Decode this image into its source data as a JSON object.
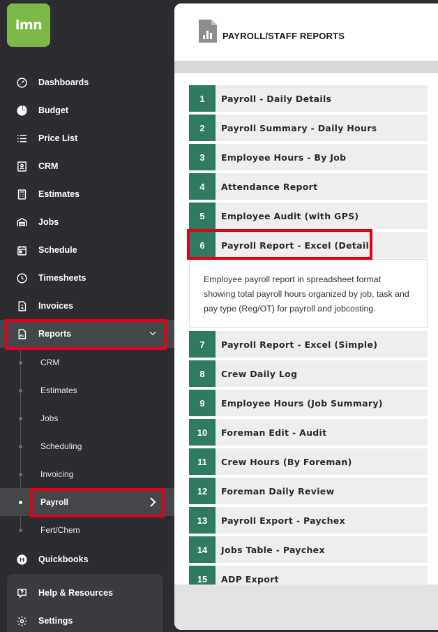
{
  "app": {
    "logo_text": "lmn",
    "brand_color": "#7cb848",
    "accent_color": "#2e7b5f"
  },
  "sidebar": {
    "items": [
      {
        "label": "Dashboards",
        "icon": "gauge-icon"
      },
      {
        "label": "Budget",
        "icon": "pie-chart-icon"
      },
      {
        "label": "Price List",
        "icon": "list-icon"
      },
      {
        "label": "CRM",
        "icon": "contact-card-icon"
      },
      {
        "label": "Estimates",
        "icon": "calculator-icon"
      },
      {
        "label": "Jobs",
        "icon": "garage-icon"
      },
      {
        "label": "Schedule",
        "icon": "calendar-icon"
      },
      {
        "label": "Timesheets",
        "icon": "clock-icon"
      },
      {
        "label": "Invoices",
        "icon": "invoice-icon"
      },
      {
        "label": "Reports",
        "icon": "report-icon"
      }
    ],
    "reports_submenu": [
      "CRM",
      "Estimates",
      "Jobs",
      "Scheduling",
      "Invoicing",
      "Payroll",
      "Fert/Chem"
    ],
    "quickbooks": "Quickbooks",
    "help": "Help & Resources",
    "settings": "Settings"
  },
  "main": {
    "title": "PAYROLL/STAFF REPORTS",
    "reports": [
      {
        "num": "1",
        "name": "Payroll - Daily Details"
      },
      {
        "num": "2",
        "name": "Payroll Summary - Daily Hours"
      },
      {
        "num": "3",
        "name": "Employee Hours - By Job"
      },
      {
        "num": "4",
        "name": "Attendance Report"
      },
      {
        "num": "5",
        "name": "Employee Audit (with GPS)"
      },
      {
        "num": "6",
        "name": "Payroll Report - Excel (Detail)"
      },
      {
        "num": "7",
        "name": "Payroll Report - Excel (Simple)"
      },
      {
        "num": "8",
        "name": "Crew Daily Log"
      },
      {
        "num": "9",
        "name": "Employee Hours (Job Summary)"
      },
      {
        "num": "10",
        "name": "Foreman Edit - Audit"
      },
      {
        "num": "11",
        "name": "Crew Hours (By Foreman)"
      },
      {
        "num": "12",
        "name": "Foreman Daily Review"
      },
      {
        "num": "13",
        "name": "Payroll Export - Paychex"
      },
      {
        "num": "14",
        "name": "Jobs Table - Paychex"
      },
      {
        "num": "15",
        "name": "ADP Export"
      }
    ],
    "expanded_description": "Employee payroll report in spreadsheet format showing total payroll hours organized by job, task and pay type (Reg/OT) for payroll and jobcosting."
  }
}
